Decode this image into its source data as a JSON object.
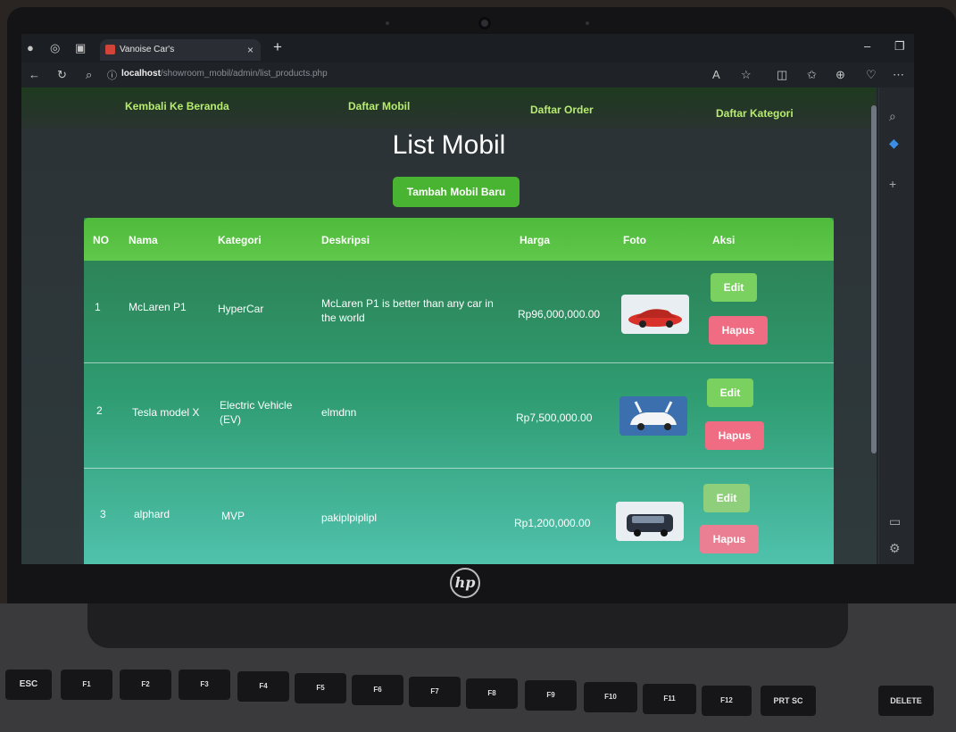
{
  "browser": {
    "tab_title": "Vanoise Car's",
    "tab_close": "×",
    "new_tab": "+",
    "url_host": "localhost",
    "url_path": "/showroom_mobil/admin/list_products.php"
  },
  "nav": {
    "home": "Kembali Ke Beranda",
    "cars": "Daftar Mobil",
    "orders": "Daftar Order",
    "categories": "Daftar Kategori"
  },
  "page": {
    "title": "List Mobil",
    "add_button": "Tambah Mobil Baru"
  },
  "table": {
    "headers": [
      "NO",
      "Nama",
      "Kategori",
      "Deskripsi",
      "Harga",
      "Foto",
      "Aksi"
    ],
    "rows": [
      {
        "no": "1",
        "name": "McLaren P1",
        "category": "HyperCar",
        "description": "McLaren P1 is better than any car in the world",
        "price": "Rp96,000,000.00",
        "photo_color": "#d8322a",
        "edit": "Edit",
        "delete": "Hapus"
      },
      {
        "no": "2",
        "name": "Tesla model X",
        "category": "Electric Vehicle (EV)",
        "description": "elmdnn",
        "price": "Rp7,500,000.00",
        "photo_color": "#f2f4f6",
        "edit": "Edit",
        "delete": "Hapus"
      },
      {
        "no": "3",
        "name": "alphard",
        "category": "MVP",
        "description": "pakiplpiplipl",
        "price": "Rp1,200,000.00",
        "photo_color": "#2b3340",
        "edit": "Edit",
        "delete": "Hapus"
      }
    ]
  },
  "keyboard": {
    "keys": [
      "ESC",
      "F1",
      "F2",
      "F3",
      "F4",
      "F5",
      "F6",
      "F7",
      "F8",
      "F9",
      "F10",
      "F11",
      "F12",
      "PRT SC",
      "DELETE"
    ]
  },
  "brand": {
    "logo_text": "hp"
  },
  "colors": {
    "accent_green": "#49b432",
    "header_green": "#60c84a",
    "delete_pink": "#ef6c83",
    "edit_green": "#7ad160",
    "nav_text": "#b7ec6f"
  }
}
